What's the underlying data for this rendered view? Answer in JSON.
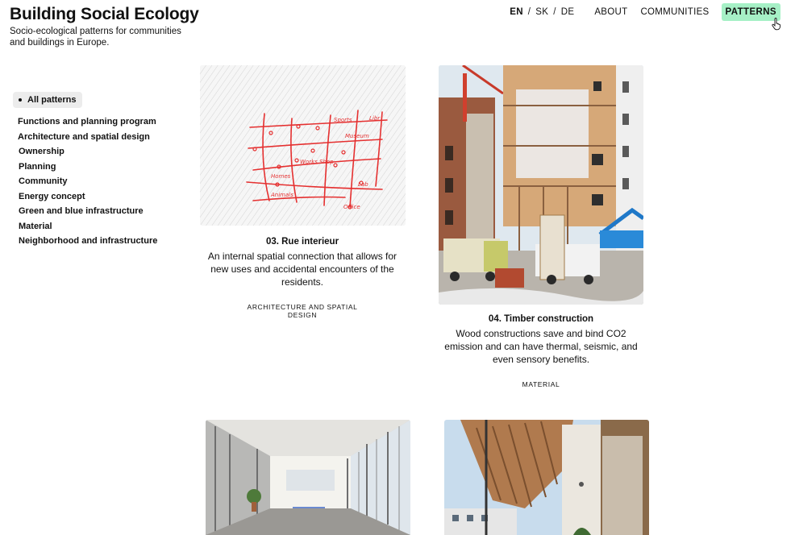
{
  "site": {
    "title": "Building Social Ecology",
    "subtitle": "Socio-ecological patterns for communities and buildings in Europe."
  },
  "nav": {
    "languages": [
      {
        "code": "EN",
        "active": true
      },
      {
        "code": "SK",
        "active": false
      },
      {
        "code": "DE",
        "active": false
      }
    ],
    "lang_separator": "/",
    "links": [
      {
        "label": "ABOUT"
      },
      {
        "label": "COMMUNITIES"
      },
      {
        "label": "PATTERNS",
        "active": true
      }
    ],
    "active_color": "#a6f0c6"
  },
  "filters": {
    "all_label": "All patterns",
    "items": [
      "Functions and planning program",
      "Architecture and spatial design",
      "Ownership",
      "Planning",
      "Community",
      "Energy concept",
      "Green and blue infrastructure",
      "Material",
      "Neighborhood and infrastructure"
    ]
  },
  "patterns": [
    {
      "number_title": "03. Rue interieur",
      "description": "An internal spatial connection that allows for new uses and accidental encounters of the residents.",
      "tag": "ARCHITECTURE AND SPATIAL DESIGN",
      "image": "hand-drawn-street-map-sketch",
      "sketch_labels": [
        "Sports",
        "Libr",
        "Museum",
        "Works Shop",
        "Homes",
        "Lab",
        "Animals",
        "Office"
      ]
    },
    {
      "number_title": "04. Timber construction",
      "description": "Wood constructions save and bind CO2 emission and can have thermal, seismic, and even sensory benefits.",
      "tag": "MATERIAL",
      "image": "timber-building-construction-site-photo"
    },
    {
      "image": "glazed-interior-corridor-photo"
    },
    {
      "image": "timber-balcony-canopy-photo"
    }
  ]
}
